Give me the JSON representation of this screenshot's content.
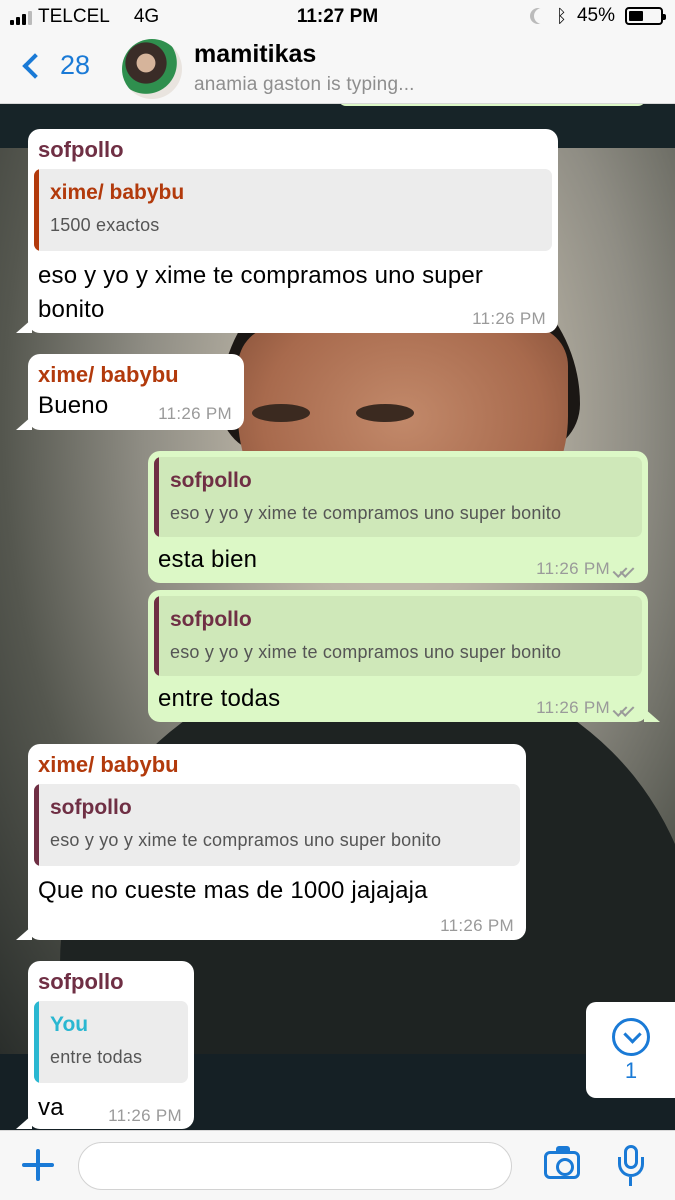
{
  "status_bar": {
    "carrier": "TELCEL",
    "network": "4G",
    "time": "11:27 PM",
    "battery_percent": "45%",
    "battery_level": 0.45
  },
  "header": {
    "back_count": "28",
    "title": "mamitikas",
    "subtitle": "anamia gaston is typing..."
  },
  "messages": [
    {
      "direction": "incoming",
      "sender": "sofpollo",
      "quote": {
        "name": "xime/ babybu",
        "text": "1500 exactos"
      },
      "body": [
        "eso y yo y xime te compramos uno super",
        "bonito"
      ],
      "time": "11:26 PM"
    },
    {
      "direction": "incoming",
      "sender": "xime/ babybu",
      "body": [
        "Bueno"
      ],
      "time": "11:26 PM"
    },
    {
      "direction": "outgoing",
      "quote": {
        "name": "sofpollo",
        "text": "eso y yo y xime te compramos uno super bonito"
      },
      "body": [
        "esta bien"
      ],
      "time": "11:26 PM",
      "status": "read"
    },
    {
      "direction": "outgoing",
      "quote": {
        "name": "sofpollo",
        "text": "eso y yo y xime te compramos uno super bonito"
      },
      "body": [
        "entre todas"
      ],
      "time": "11:26 PM",
      "status": "read"
    },
    {
      "direction": "incoming",
      "sender": "xime/ babybu",
      "quote": {
        "name": "sofpollo",
        "text": "eso y yo y xime te compramos uno super bonito"
      },
      "body": [
        "Que no cueste mas de 1000 jajajaja"
      ],
      "time": "11:26 PM"
    },
    {
      "direction": "incoming",
      "sender": "sofpollo",
      "quote": {
        "name": "You",
        "text": "entre todas"
      },
      "body": [
        "va"
      ],
      "time": "11:26 PM"
    }
  ],
  "scroll_button": {
    "count": "1"
  },
  "input": {
    "placeholder": "",
    "value": ""
  },
  "colors": {
    "accent": "#1a7ad6",
    "outgoing_bubble": "#dcf8c6",
    "incoming_bubble": "#ffffff",
    "sender_sofpollo": "#6f2f44",
    "sender_xime": "#b23a0c",
    "quote_you": "#2ab7d1"
  },
  "icons": [
    "signal-icon",
    "moon-icon",
    "bluetooth-icon",
    "battery-icon",
    "back-chevron-icon",
    "plus-icon",
    "camera-icon",
    "microphone-icon",
    "scroll-down-icon",
    "double-check-icon"
  ]
}
